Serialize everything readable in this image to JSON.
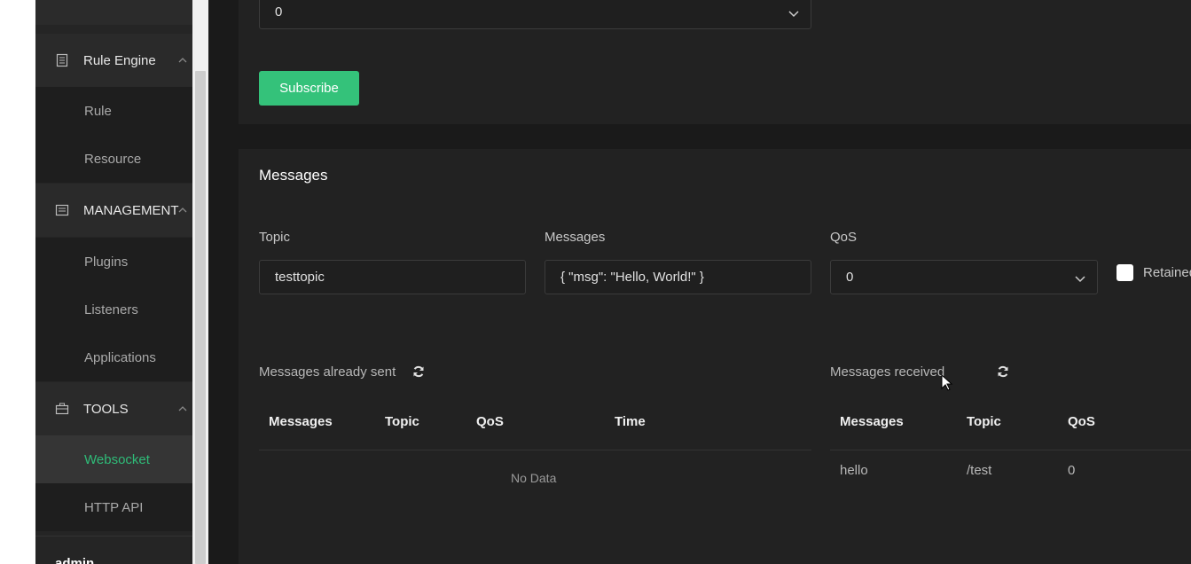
{
  "sidebar": {
    "groups": [
      {
        "label": "Rule Engine",
        "icon": "document-icon"
      },
      {
        "label": "MANAGEMENT",
        "icon": "list-box-icon"
      },
      {
        "label": "TOOLS",
        "icon": "toolbox-icon"
      }
    ],
    "items": {
      "rule": "Rule",
      "resource": "Resource",
      "plugins": "Plugins",
      "listeners": "Listeners",
      "applications": "Applications",
      "websocket": "Websocket",
      "http_api": "HTTP API"
    },
    "user": "admin"
  },
  "subscribe": {
    "qos_value": "0",
    "button_label": "Subscribe"
  },
  "messages": {
    "title": "Messages",
    "topic_label": "Topic",
    "topic_value": "testtopic",
    "message_label": "Messages",
    "message_value": "{ \"msg\": \"Hello, World!\" }",
    "qos_label": "QoS",
    "qos_value": "0",
    "retained_label": "Retained"
  },
  "sent": {
    "title": "Messages already sent",
    "columns": [
      "Messages",
      "Topic",
      "QoS",
      "Time"
    ],
    "empty_text": "No Data"
  },
  "received": {
    "title": "Messages received",
    "columns": [
      "Messages",
      "Topic",
      "QoS"
    ],
    "rows": [
      {
        "message": "hello",
        "topic": "/test",
        "qos": "0"
      }
    ]
  },
  "colors": {
    "accent": "#34c27a",
    "background": "#1a1a1a",
    "panel": "#222222"
  }
}
